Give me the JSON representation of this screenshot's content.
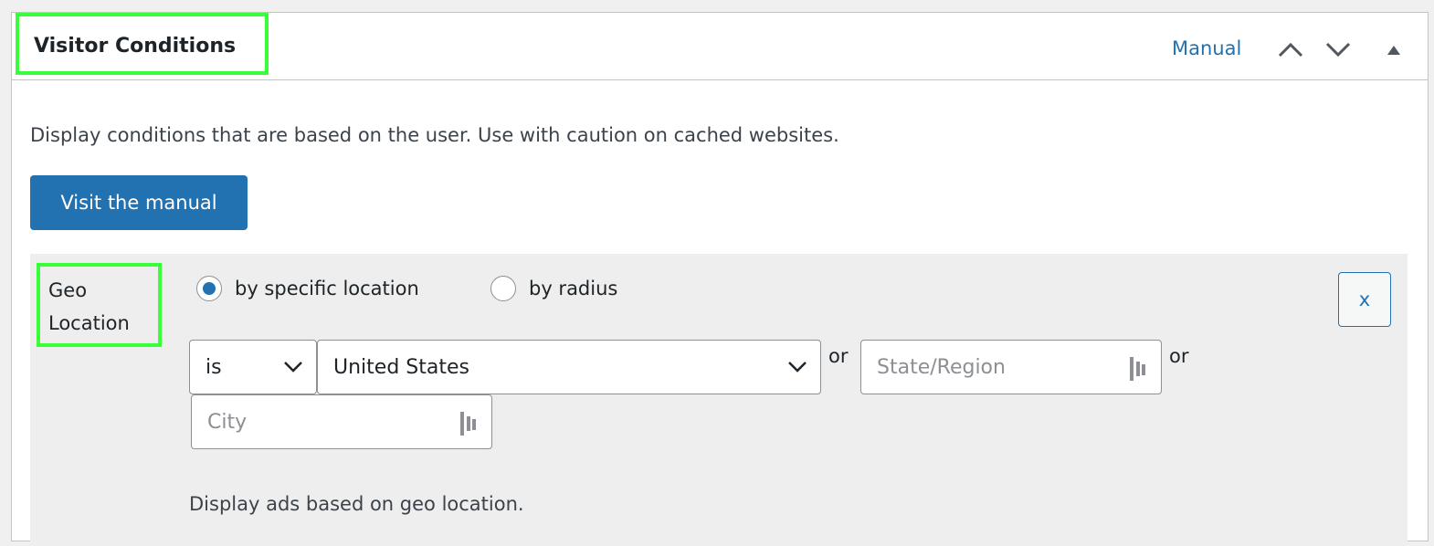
{
  "box": {
    "title": "Visitor Conditions",
    "manual_link": "Manual",
    "move_up": "chevron-up",
    "move_down": "chevron-down",
    "toggle": "triangle-up"
  },
  "description": "Display conditions that are based on the user. Use with caution on cached websites.",
  "visit_button": "Visit the manual",
  "condition": {
    "label": "Geo Location",
    "radios": [
      {
        "label": "by specific location",
        "checked": true
      },
      {
        "label": "by radius",
        "checked": false
      }
    ],
    "operator": "is",
    "country": "United States",
    "or1": "or",
    "or2": "or",
    "state_placeholder": "State/Region",
    "city_placeholder": "City",
    "remove": "x",
    "hint": "Display ads based on geo location."
  },
  "colors": {
    "accent": "#2271b1",
    "highlight": "#39ff39"
  }
}
